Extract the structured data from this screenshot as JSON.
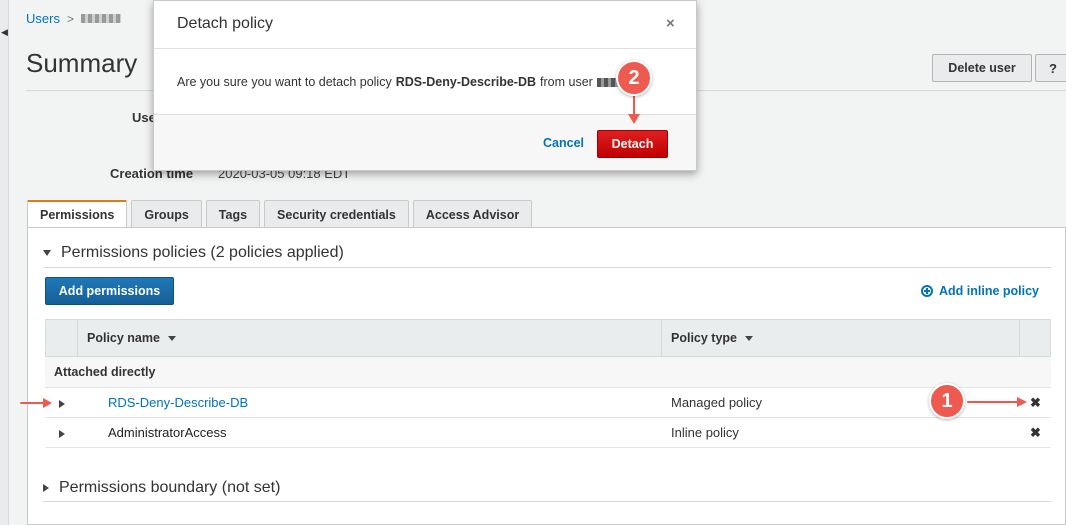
{
  "breadcrumb": {
    "users_link": "Users",
    "separator": ">"
  },
  "page": {
    "title": "Summary"
  },
  "header_buttons": {
    "delete_user": "Delete user",
    "help": "?"
  },
  "summary": {
    "user_label": "User",
    "creation_label": "Creation time",
    "creation_value": "2020-03-05 09:18 EDT"
  },
  "tabs": [
    {
      "label": "Permissions",
      "active": true
    },
    {
      "label": "Groups"
    },
    {
      "label": "Tags"
    },
    {
      "label": "Security credentials"
    },
    {
      "label": "Access Advisor"
    }
  ],
  "permissions": {
    "section_title": "Permissions policies (2 policies applied)",
    "add_permissions": "Add permissions",
    "add_inline_policy": "Add inline policy",
    "table": {
      "col_policy_name": "Policy name",
      "col_policy_type": "Policy type",
      "group_label": "Attached directly",
      "rows": [
        {
          "name": "RDS-Deny-Describe-DB",
          "type": "Managed policy",
          "remove": "✖"
        },
        {
          "name": "AdministratorAccess",
          "type": "Inline policy",
          "remove": "✖"
        }
      ]
    },
    "boundary_title": "Permissions boundary (not set)"
  },
  "modal": {
    "title": "Detach policy",
    "close": "×",
    "message_prefix": "Are you sure you want to detach policy",
    "policy_name": "RDS-Deny-Describe-DB",
    "message_mid": "from user",
    "message_suffix": "?",
    "cancel": "Cancel",
    "detach": "Detach"
  },
  "annotations": {
    "step1": "1",
    "step2": "2",
    "color": "#ee5a4f"
  }
}
